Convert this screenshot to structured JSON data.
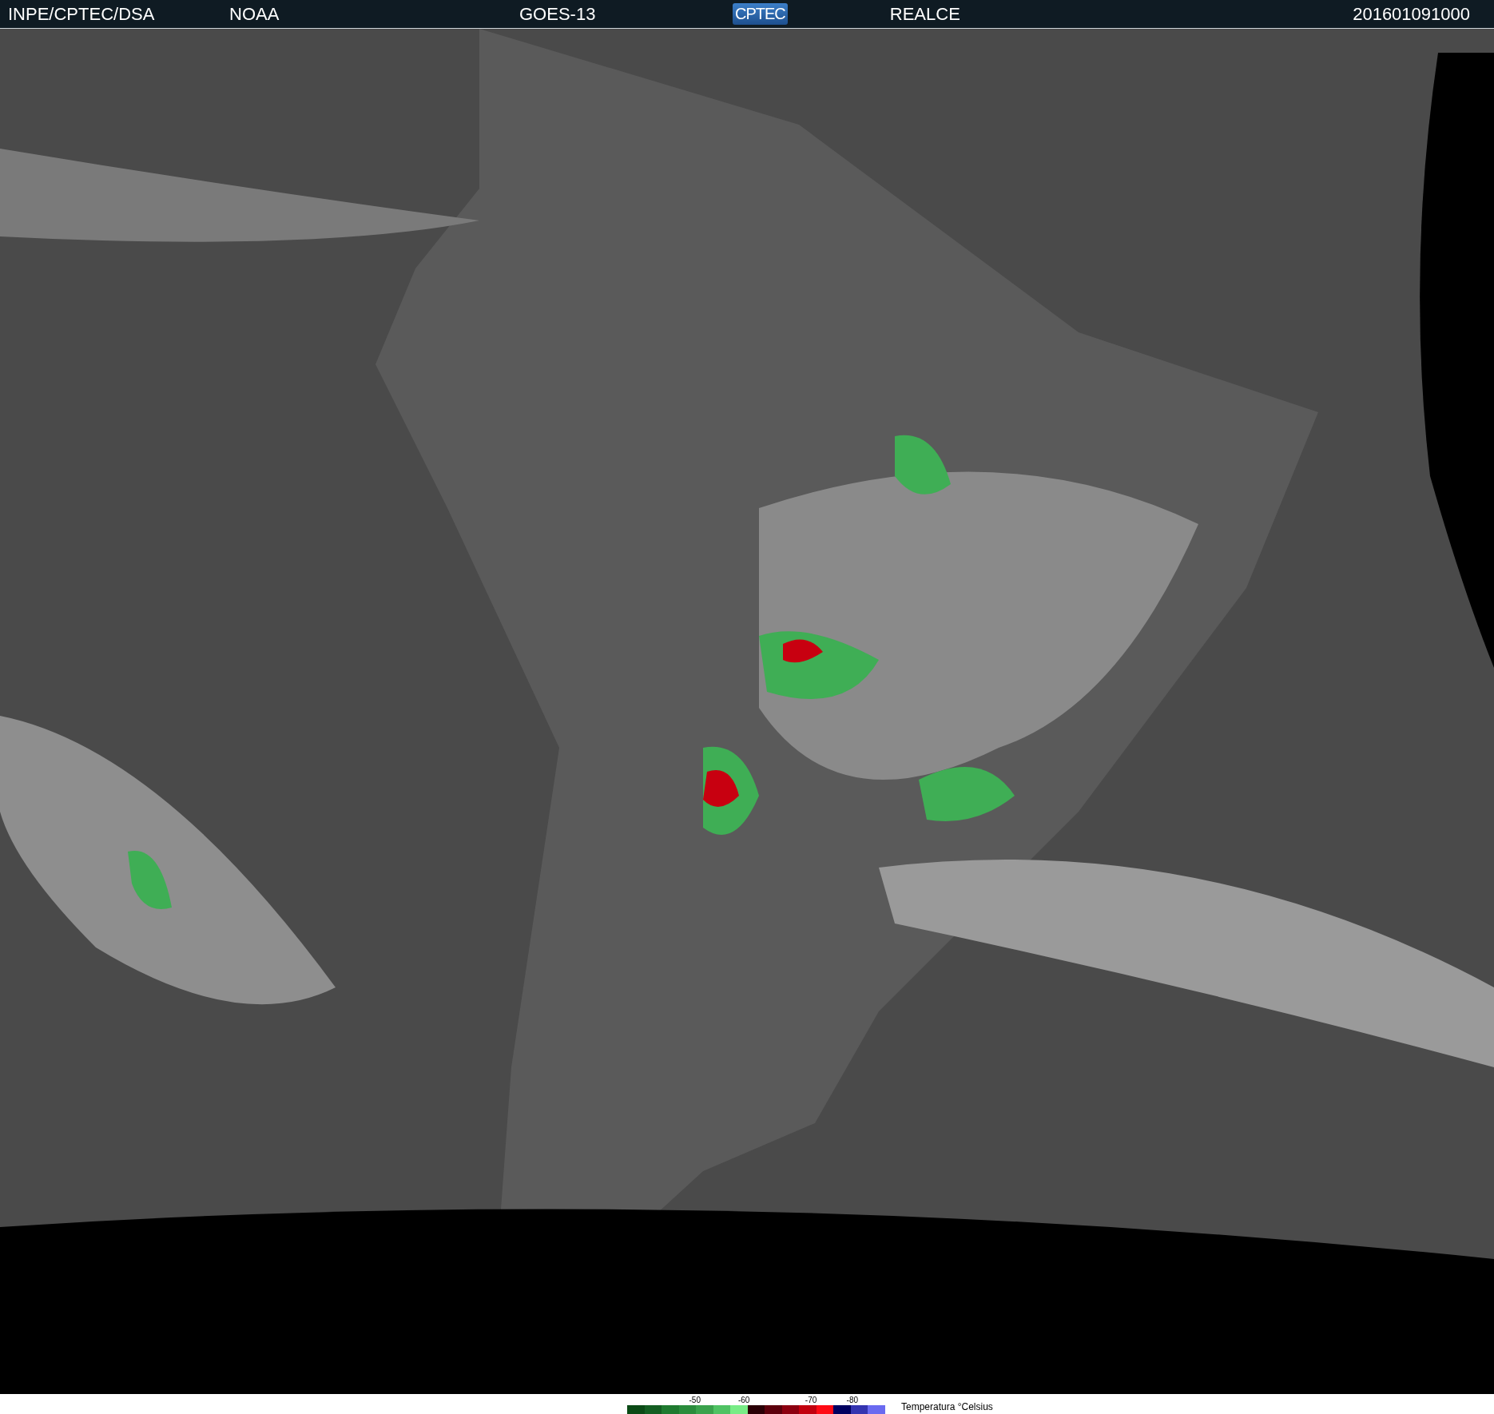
{
  "header": {
    "source": "INPE/CPTEC/DSA",
    "agency": "NOAA",
    "satellite": "GOES-13",
    "logo": "CPTEC",
    "product": "REALCE",
    "timestamp": "201601091000"
  },
  "legend": {
    "ticks": [
      "-50",
      "-60",
      "-70",
      "-80"
    ],
    "title": "Temperatura °Celsius",
    "swatches": [
      {
        "color": "#0b4a16"
      },
      {
        "color": "#145e22"
      },
      {
        "color": "#1f7a30"
      },
      {
        "color": "#2a8c3c"
      },
      {
        "color": "#3aa24c"
      },
      {
        "color": "#4fc263"
      },
      {
        "color": "#78ec86"
      },
      {
        "color": "#2a0006"
      },
      {
        "color": "#5c000c"
      },
      {
        "color": "#8c0010"
      },
      {
        "color": "#c2000e"
      },
      {
        "color": "#ff0a14"
      },
      {
        "color": "#000060"
      },
      {
        "color": "#3434b0"
      },
      {
        "color": "#6a6af0"
      }
    ]
  }
}
